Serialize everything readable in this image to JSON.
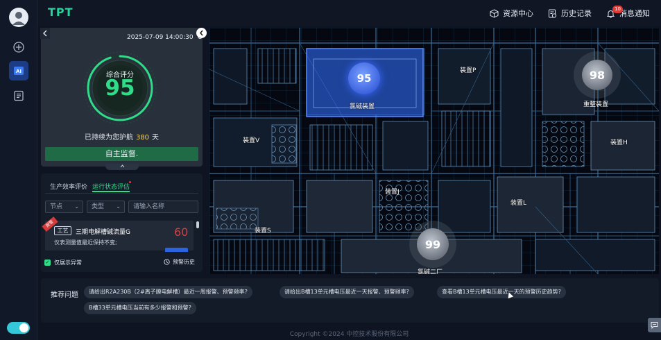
{
  "app": {
    "brand": "TPT"
  },
  "topnav": {
    "items": [
      {
        "label": "资源中心",
        "icon": "cube-icon"
      },
      {
        "label": "历史记录",
        "icon": "history-doc-icon"
      },
      {
        "label": "消息通知",
        "icon": "bell-icon",
        "badge": "10"
      }
    ]
  },
  "score_panel": {
    "datetime": "2025-07-09 14:00:30",
    "score_label": "综合评分",
    "score_value": "95",
    "guard_prefix": "已持续为您护航",
    "guard_days": "380",
    "guard_suffix": "天",
    "action_label": "自主监督."
  },
  "eval_panel": {
    "tabs": [
      {
        "label": "生产效率评价"
      },
      {
        "label": "运行状态评估"
      }
    ],
    "active_tab": "运行状态评估",
    "filters": {
      "node_label": "节点",
      "type_label": "类型",
      "name_placeholder": "请输入名称"
    },
    "alerts": [
      {
        "ribbon": "报警",
        "tag": "工艺",
        "title": "三期电解槽碱流量G",
        "score": "60",
        "desc": "仪表测量值最近保持不变;"
      }
    ],
    "only_abnormal_label": "仅展示异常",
    "alarm_history_label": "预警历史"
  },
  "map": {
    "units": [
      {
        "label": "氯碱装置",
        "score": "95",
        "state": "selected"
      },
      {
        "label": "装置P"
      },
      {
        "label": "重整装置",
        "score": "98"
      },
      {
        "label": "装置V"
      },
      {
        "label": "装置H"
      },
      {
        "label": "装置J"
      },
      {
        "label": "装置L"
      },
      {
        "label": "装置S"
      },
      {
        "label": "氯碱二厂",
        "score": "99"
      }
    ]
  },
  "recommend": {
    "title": "推荐问题",
    "questions": [
      "请给出R2A230B（2#离子膜电解槽）最近一周报警、预警频率?",
      "请给出B槽13单元槽电压最近一天报警、预警频率?",
      "查看B槽13单元槽电压最近一天的预警历史趋势?",
      "B槽33单元槽电压当前有多少报警和预警?"
    ]
  },
  "footer": {
    "copyright": "Copyright ©2024 中控技术股份有限公司"
  },
  "colors": {
    "accent": "#2fdc88",
    "brand": "#27d39a",
    "alert": "#e03b3b",
    "selection": "#2f6cff"
  }
}
